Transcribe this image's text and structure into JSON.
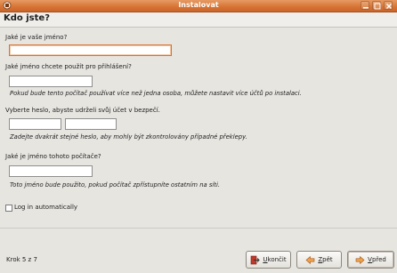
{
  "window": {
    "title": "Instalovat"
  },
  "page": {
    "heading": "Kdo jste?"
  },
  "form": {
    "name_label": "Jaké je vaše jméno?",
    "name_value": "",
    "login_label": "Jaké jméno chcete použít pro přihlášení?",
    "login_value": "",
    "login_hint": "Pokud bude tento počítač používat více než jedna osoba, můžete nastavit více účtů po instalaci.",
    "password_label": "Vyberte heslo, abyste udrželi svůj účet v bezpečí.",
    "password_value": "",
    "password_confirm_value": "",
    "password_hint": "Zadejte dvakrát stejné heslo, aby mohly být zkontrolovány případné překlepy.",
    "hostname_label": "Jaké je jméno tohoto počítače?",
    "hostname_value": "",
    "hostname_hint": "Toto jméno bude použito, pokud počítač zpřístupníte ostatním na síti.",
    "autologin_label": "Log in automatically",
    "autologin_checked": false
  },
  "footer": {
    "step_text": "Krok 5 z 7",
    "quit_label": "Ukončit",
    "quit_accel": "U",
    "back_label": "Zpět",
    "back_accel": "Z",
    "forward_label": "Vpřed",
    "forward_accel": "V"
  },
  "colors": {
    "titlebar": "#d67433",
    "focus": "#d67433"
  }
}
